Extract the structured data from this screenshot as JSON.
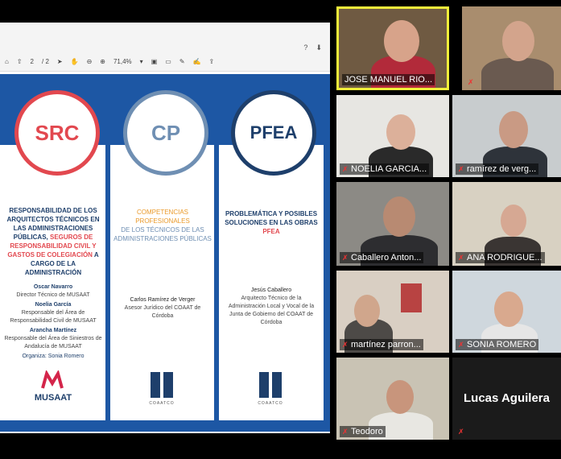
{
  "pdf_toolbar": {
    "page_current": "2",
    "page_total": "/ 2",
    "zoom": "71,4%",
    "right_icons": [
      "help-icon",
      "save-icon"
    ]
  },
  "slide": {
    "src": {
      "acronym": "SRC",
      "desc_part1": "RESPONSABILIDAD DE LOS ARQUITECTOS TÉCNICOS EN LAS ADMINISTRACIONES PÚBLICAS,",
      "desc_part2": "SEGUROS DE RESPONSABILIDAD CIVIL Y GASTOS DE COLEGIACIÓN",
      "desc_part3": "A CARGO DE LA ADMINISTRACIÓN",
      "speaker1_name": "Oscar Navarro",
      "speaker1_role": "Director Técnico de MUSAAT",
      "speaker2_name": "Noelia García",
      "speaker2_role": "Responsable del Área de Responsabilidad Civil de MUSAAT",
      "speaker3_name": "Arancha Martínez",
      "speaker3_role": "Responsable del Área de Siniestros de Andalucía de MUSAAT",
      "organiza": "Organiza: Sonia Romero",
      "logo_text": "MUSAAT"
    },
    "cp": {
      "acronym": "CP",
      "desc_part1": "COMPETENCIAS PROFESIONALES",
      "desc_part2": "DE LOS TÉCNICOS DE LAS ADMINISTRACIONES PÚBLICAS",
      "speaker_name": "Carlos Ramírez de Verger",
      "speaker_role": "Asesor Jurídico del COAAT de Córdoba",
      "logo_text": "COAATCO"
    },
    "pfea": {
      "acronym": "PFEA",
      "desc_part1": "PROBLEMÁTICA Y POSIBLES SOLUCIONES EN LAS OBRAS",
      "desc_part2": "PFEA",
      "speaker_name": "Jesús Caballero",
      "speaker_role": "Arquitecto Técnico de la Administración Local y Vocal de la Junta de Gobierno del COAAT de Córdoba",
      "logo_text": "COAATCO"
    }
  },
  "participants": [
    {
      "name": "JOSE MANUEL RIO..."
    },
    {
      "name": ""
    },
    {
      "name": "NOELIA GARCIA..."
    },
    {
      "name": "ramírez de verg..."
    },
    {
      "name": "Caballero Anton..."
    },
    {
      "name": "ANA RODRIGUE..."
    },
    {
      "name": "martínez parron..."
    },
    {
      "name": "SONIA ROMERO"
    },
    {
      "name": "Teodoro"
    },
    {
      "name": "Lucas Aguilera"
    }
  ],
  "colors": {
    "src": "#e2484f",
    "cp": "#6f8fb3",
    "pfea": "#1e3f6b",
    "slide_bg": "#1d57a4",
    "active_speaker_border": "#f0ee3a"
  }
}
